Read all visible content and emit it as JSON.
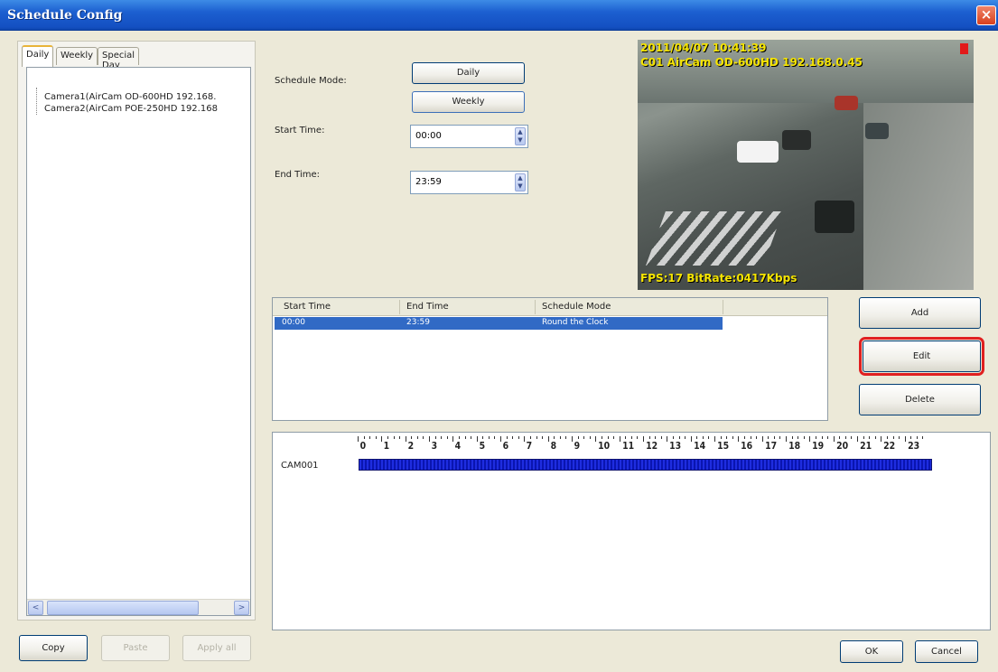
{
  "window": {
    "title": "Schedule Config",
    "close_glyph": "×"
  },
  "tabs": [
    "Daily",
    "Weekly",
    "Special Day"
  ],
  "tree": {
    "items": [
      "Camera1(AirCam OD-600HD 192.168.",
      "Camera2(AirCam POE-250HD 192.168"
    ],
    "scroll_left": "<",
    "scroll_right": ">"
  },
  "left_buttons": {
    "copy": "Copy",
    "paste": "Paste",
    "apply_all": "Apply all"
  },
  "schedule": {
    "mode_label": "Schedule Mode:",
    "daily_button": "Daily",
    "weekly_button": "Weekly",
    "start_label": "Start Time:",
    "start_value": "00:00",
    "end_label": "End Time:",
    "end_value": "23:59",
    "spin_up": "▲",
    "spin_down": "▼"
  },
  "camera_view": {
    "timestamp": "2011/04/07 10:41:39",
    "camera_line": "C01 AirCam OD-600HD 192.168.0.45",
    "stats": "FPS:17 BitRate:0417Kbps",
    "rec_color": "#e21a1a"
  },
  "schedule_list": {
    "columns": [
      "Start Time",
      "End Time",
      "Schedule Mode"
    ],
    "rows": [
      {
        "start": "00:00",
        "end": "23:59",
        "mode": "Round the Clock"
      }
    ],
    "selected_color": "#316ac5"
  },
  "actions": {
    "add": "Add",
    "edit": "Edit",
    "delete": "Delete"
  },
  "timeline": {
    "hours": [
      "0",
      "1",
      "2",
      "3",
      "4",
      "5",
      "6",
      "7",
      "8",
      "9",
      "10",
      "11",
      "12",
      "13",
      "14",
      "15",
      "16",
      "17",
      "18",
      "19",
      "20",
      "21",
      "22",
      "23"
    ],
    "camera": "CAM001",
    "bar_color": "#1e2de0"
  },
  "dialog_buttons": {
    "ok": "OK",
    "cancel": "Cancel"
  }
}
